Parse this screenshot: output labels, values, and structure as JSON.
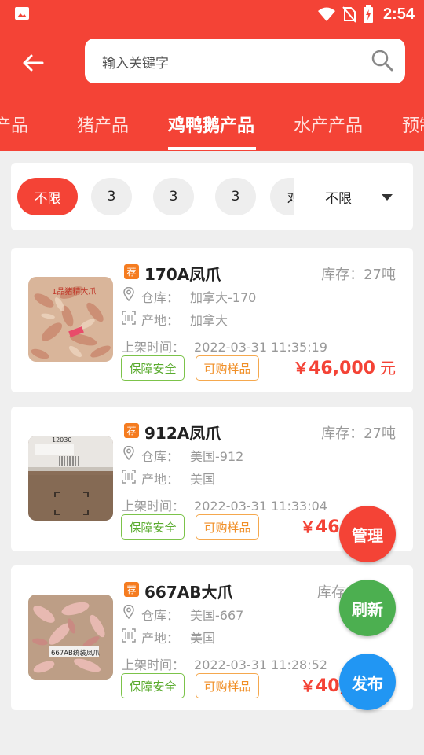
{
  "status_bar": {
    "time": "2:54",
    "icons": [
      "image-icon",
      "wifi-icon",
      "no-sim-icon",
      "battery-icon"
    ]
  },
  "search": {
    "placeholder": "输入关键字"
  },
  "tabs": [
    {
      "label": "禽产品",
      "active": false
    },
    {
      "label": "猪产品",
      "active": false
    },
    {
      "label": "鸡鸭鹅产品",
      "active": true
    },
    {
      "label": "水产产品",
      "active": false
    },
    {
      "label": "预制",
      "active": false
    }
  ],
  "filter": {
    "chips": [
      "不限",
      "3",
      "3",
      "3",
      "鸡"
    ],
    "dropdown": "不限"
  },
  "products": [
    {
      "badge": "荐",
      "title": "170A凤爪",
      "stock": "库存：27吨",
      "warehouse_label": "仓库：",
      "warehouse": "加拿大-170",
      "origin_label": "产地：",
      "origin": "加拿大",
      "date_label": "上架时间：",
      "date": "2022-03-31 11:35:19",
      "tag_safe": "保障安全",
      "tag_sample": "可购样品",
      "price_symbol": "￥",
      "price": "46,000",
      "price_unit": "元",
      "thumb_text": "1品猪精大爪"
    },
    {
      "badge": "荐",
      "title": "912A凤爪",
      "stock": "库存：27吨",
      "warehouse_label": "仓库：",
      "warehouse": "美国-912",
      "origin_label": "产地：",
      "origin": "美国",
      "date_label": "上架时间：",
      "date": "2022-03-31 11:33:04",
      "tag_safe": "保障安全",
      "tag_sample": "可购样品",
      "price_symbol": "￥",
      "price": "46,",
      "price_unit": "",
      "thumb_text": "12030"
    },
    {
      "badge": "荐",
      "title": "667AB大爪",
      "stock": "库存",
      "warehouse_label": "仓库：",
      "warehouse": "美国-667",
      "origin_label": "产地：",
      "origin": "美国",
      "date_label": "上架时间：",
      "date": "2022-03-31 11:28:52",
      "tag_safe": "保障安全",
      "tag_sample": "可购样品",
      "price_symbol": "￥",
      "price": "40,",
      "price_unit": "",
      "thumb_text": "667AB统装凤爪"
    }
  ],
  "fabs": {
    "manage": "管理",
    "refresh": "刷新",
    "publish": "发布"
  },
  "colors": {
    "brand": "#f44336",
    "green": "#4caf50",
    "blue": "#2196f3",
    "tag_green": "#7cc34a",
    "tag_orange": "#f5a84e"
  }
}
